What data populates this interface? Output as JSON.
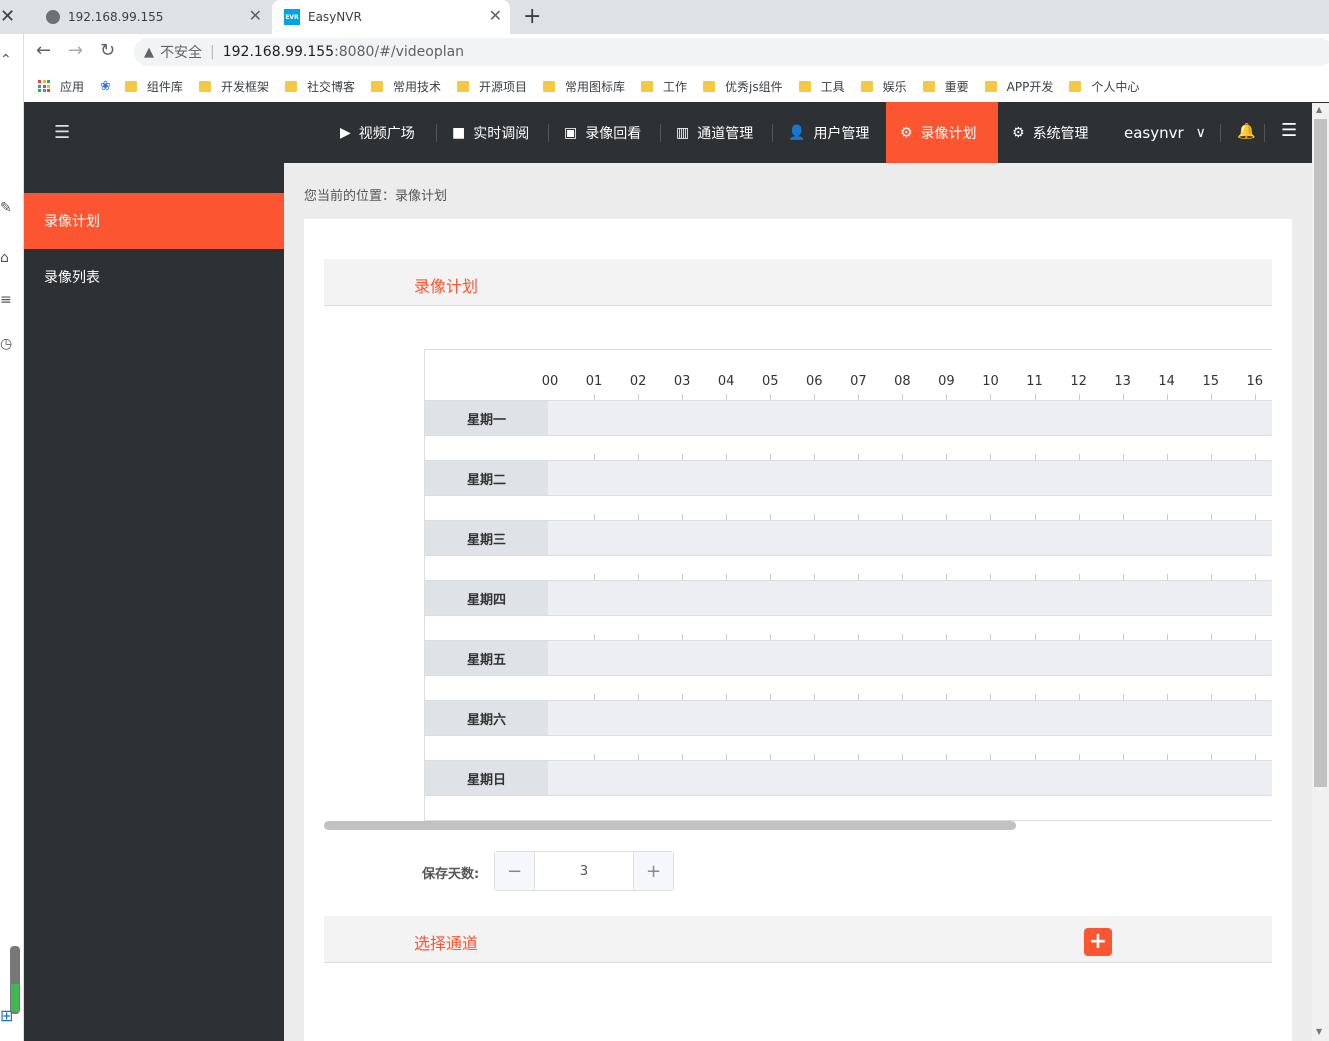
{
  "browser": {
    "tabs": [
      {
        "title": "192.168.99.155",
        "icon": "globe-icon"
      },
      {
        "title": "EasyNVR",
        "icon": "easynvr-favicon",
        "active": true
      }
    ],
    "tab_close": "✕",
    "new_tab": "+",
    "address": {
      "security_label": "不安全",
      "host": "192.168.99.155",
      "path": ":8080/#/videoplan"
    },
    "bookmarks": [
      "应用",
      "组件库",
      "开发框架",
      "社交博客",
      "常用技术",
      "开源项目",
      "常用图标库",
      "工作",
      "优秀js组件",
      "工具",
      "娱乐",
      "重要",
      "APP开发",
      "个人中心"
    ]
  },
  "header": {
    "nav": [
      {
        "label": "视频广场",
        "icon": "play-circle-icon",
        "glyph": "▶"
      },
      {
        "label": "实时调阅",
        "icon": "video-camera-icon",
        "glyph": "■"
      },
      {
        "label": "录像回看",
        "icon": "tv-icon",
        "glyph": "▣"
      },
      {
        "label": "通道管理",
        "icon": "columns-icon",
        "glyph": "▥"
      },
      {
        "label": "用户管理",
        "icon": "user-gear-icon",
        "glyph": "👤"
      },
      {
        "label": "录像计划",
        "icon": "film-reel-icon",
        "glyph": "⚙",
        "active": true
      },
      {
        "label": "系统管理",
        "icon": "gear-icon",
        "glyph": "⚙"
      }
    ],
    "user": "easynvr",
    "accent_color": "#fc5531",
    "bg_color": "#2e3134"
  },
  "sidebar": {
    "items": [
      {
        "label": "录像计划",
        "active": true
      },
      {
        "label": "录像列表"
      }
    ]
  },
  "breadcrumb": "您当前的位置：录像计划",
  "plan_section": {
    "title": "录像计划"
  },
  "schedule": {
    "hours": [
      "00",
      "01",
      "02",
      "03",
      "04",
      "05",
      "06",
      "07",
      "08",
      "09",
      "10",
      "11",
      "12",
      "13",
      "14",
      "15",
      "16"
    ],
    "days": [
      "星期一",
      "星期二",
      "星期三",
      "星期四",
      "星期五",
      "星期六",
      "星期日"
    ]
  },
  "retention": {
    "label": "保存天数:",
    "value": "3",
    "minus": "−",
    "plus": "+"
  },
  "channel_section": {
    "title": "选择通道",
    "add": "+"
  }
}
